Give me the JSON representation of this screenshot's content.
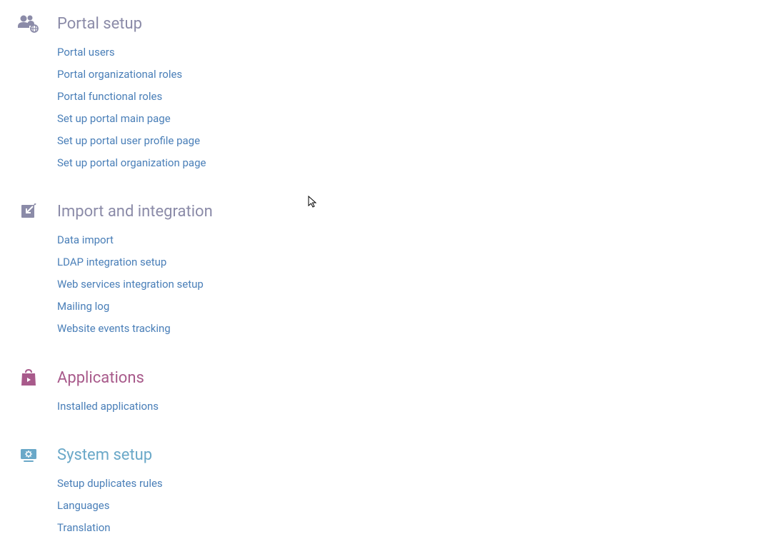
{
  "sections": [
    {
      "id": "portal-setup",
      "title": "Portal setup",
      "titleClass": "",
      "icon": "users-globe-icon",
      "links": [
        {
          "id": "portal-users",
          "label": "Portal users"
        },
        {
          "id": "portal-org-roles",
          "label": "Portal organizational roles"
        },
        {
          "id": "portal-func-roles",
          "label": "Portal functional roles"
        },
        {
          "id": "setup-main-page",
          "label": "Set up portal main page"
        },
        {
          "id": "setup-user-profile",
          "label": "Set up portal user profile page"
        },
        {
          "id": "setup-org-page",
          "label": "Set up portal organization page"
        }
      ]
    },
    {
      "id": "import-integration",
      "title": "Import and integration",
      "titleClass": "",
      "icon": "import-arrow-icon",
      "links": [
        {
          "id": "data-import",
          "label": "Data import"
        },
        {
          "id": "ldap-setup",
          "label": "LDAP integration setup"
        },
        {
          "id": "web-services-setup",
          "label": "Web services integration setup"
        },
        {
          "id": "mailing-log",
          "label": "Mailing log"
        },
        {
          "id": "website-events",
          "label": "Website events tracking"
        }
      ]
    },
    {
      "id": "applications",
      "title": "Applications",
      "titleClass": "applications",
      "icon": "shopping-bag-icon",
      "links": [
        {
          "id": "installed-apps",
          "label": "Installed applications"
        }
      ]
    },
    {
      "id": "system-setup",
      "title": "System setup",
      "titleClass": "system",
      "icon": "monitor-gear-icon",
      "links": [
        {
          "id": "setup-duplicates",
          "label": "Setup duplicates rules"
        },
        {
          "id": "languages",
          "label": "Languages"
        },
        {
          "id": "translation",
          "label": "Translation"
        }
      ]
    }
  ]
}
